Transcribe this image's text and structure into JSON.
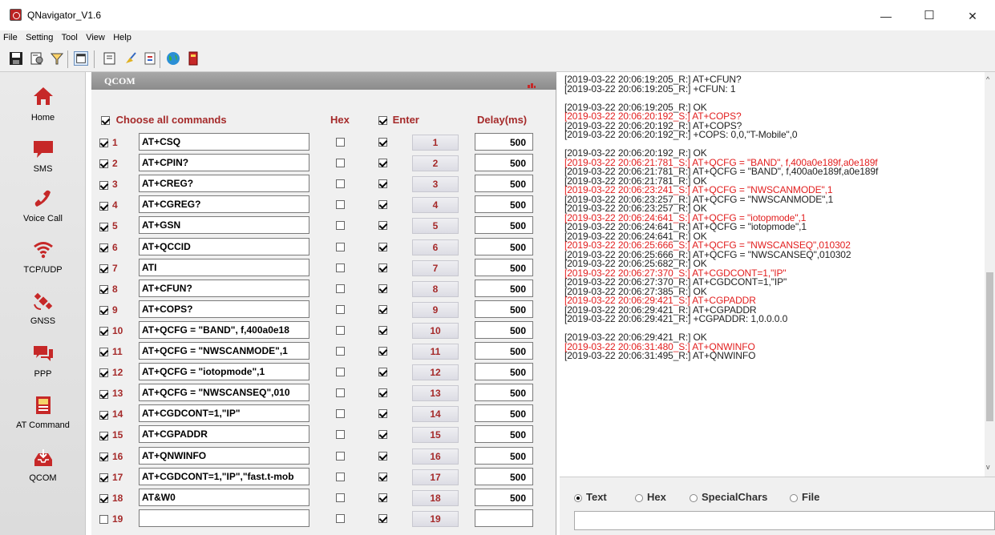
{
  "window": {
    "title": "QNavigator_V1.6",
    "minimize": "—",
    "maximize": "☐",
    "close": "✕"
  },
  "menu": [
    "File",
    "Setting",
    "Tool",
    "View",
    "Help"
  ],
  "toolbar_icons": [
    "save-icon",
    "settings-icon",
    "filter-icon",
    "new-window-icon",
    "edit-icon",
    "clear-icon",
    "notes-icon",
    "globe-icon",
    "book-icon"
  ],
  "sidebar": [
    {
      "label": "Home",
      "icon": "home-icon"
    },
    {
      "label": "SMS",
      "icon": "sms-icon"
    },
    {
      "label": "Voice Call",
      "icon": "phone-icon"
    },
    {
      "label": "TCP/UDP",
      "icon": "wifi-icon"
    },
    {
      "label": "GNSS",
      "icon": "satellite-icon"
    },
    {
      "label": "PPP",
      "icon": "chat-icon"
    },
    {
      "label": "AT Command",
      "icon": "terminal-icon"
    },
    {
      "label": "QCOM",
      "icon": "inbox-icon"
    }
  ],
  "panel": {
    "title": "QCOM",
    "choose_all": "Choose all commands",
    "hex": "Hex",
    "enter": "Enter",
    "delay": "Delay(ms)"
  },
  "commands": [
    {
      "num": "1",
      "checked": true,
      "cmd": "AT+CSQ",
      "hex": false,
      "enter": true,
      "btn": "1",
      "delay": "500"
    },
    {
      "num": "2",
      "checked": true,
      "cmd": "AT+CPIN?",
      "hex": false,
      "enter": true,
      "btn": "2",
      "delay": "500"
    },
    {
      "num": "3",
      "checked": true,
      "cmd": "AT+CREG?",
      "hex": false,
      "enter": true,
      "btn": "3",
      "delay": "500"
    },
    {
      "num": "4",
      "checked": true,
      "cmd": "AT+CGREG?",
      "hex": false,
      "enter": true,
      "btn": "4",
      "delay": "500"
    },
    {
      "num": "5",
      "checked": true,
      "cmd": "AT+GSN",
      "hex": false,
      "enter": true,
      "btn": "5",
      "delay": "500"
    },
    {
      "num": "6",
      "checked": true,
      "cmd": "AT+QCCID",
      "hex": false,
      "enter": true,
      "btn": "6",
      "delay": "500"
    },
    {
      "num": "7",
      "checked": true,
      "cmd": "ATI",
      "hex": false,
      "enter": true,
      "btn": "7",
      "delay": "500"
    },
    {
      "num": "8",
      "checked": true,
      "cmd": "AT+CFUN?",
      "hex": false,
      "enter": true,
      "btn": "8",
      "delay": "500"
    },
    {
      "num": "9",
      "checked": true,
      "cmd": "AT+COPS?",
      "hex": false,
      "enter": true,
      "btn": "9",
      "delay": "500"
    },
    {
      "num": "10",
      "checked": true,
      "cmd": "AT+QCFG = \"BAND\", f,400a0e18",
      "hex": false,
      "enter": true,
      "btn": "10",
      "delay": "500"
    },
    {
      "num": "11",
      "checked": true,
      "cmd": "AT+QCFG = \"NWSCANMODE\",1",
      "hex": false,
      "enter": true,
      "btn": "11",
      "delay": "500"
    },
    {
      "num": "12",
      "checked": true,
      "cmd": "AT+QCFG = \"iotopmode\",1",
      "hex": false,
      "enter": true,
      "btn": "12",
      "delay": "500"
    },
    {
      "num": "13",
      "checked": true,
      "cmd": "AT+QCFG = \"NWSCANSEQ\",010",
      "hex": false,
      "enter": true,
      "btn": "13",
      "delay": "500"
    },
    {
      "num": "14",
      "checked": true,
      "cmd": "AT+CGDCONT=1,\"IP\"",
      "hex": false,
      "enter": true,
      "btn": "14",
      "delay": "500"
    },
    {
      "num": "15",
      "checked": true,
      "cmd": "AT+CGPADDR",
      "hex": false,
      "enter": true,
      "btn": "15",
      "delay": "500"
    },
    {
      "num": "16",
      "checked": true,
      "cmd": "AT+QNWINFO",
      "hex": false,
      "enter": true,
      "btn": "16",
      "delay": "500"
    },
    {
      "num": "17",
      "checked": true,
      "cmd": "AT+CGDCONT=1,\"IP\",\"fast.t-mob",
      "hex": false,
      "enter": true,
      "btn": "17",
      "delay": "500"
    },
    {
      "num": "18",
      "checked": true,
      "cmd": "AT&W0",
      "hex": false,
      "enter": true,
      "btn": "18",
      "delay": "500"
    },
    {
      "num": "19",
      "checked": false,
      "cmd": "",
      "hex": false,
      "enter": true,
      "btn": "19",
      "delay": ""
    }
  ],
  "log": [
    {
      "t": "[2019-03-22 20:06:19:205_R:] AT+CFUN?",
      "s": false
    },
    {
      "t": "[2019-03-22 20:06:19:205_R:] +CFUN: 1",
      "s": false
    },
    {
      "t": "",
      "s": false
    },
    {
      "t": "[2019-03-22 20:06:19:205_R:] OK",
      "s": false
    },
    {
      "t": "[2019-03-22 20:06:20:192_S:] AT+COPS?",
      "s": true
    },
    {
      "t": "[2019-03-22 20:06:20:192_R:] AT+COPS?",
      "s": false
    },
    {
      "t": "[2019-03-22 20:06:20:192_R:] +COPS: 0,0,\"T-Mobile\",0",
      "s": false
    },
    {
      "t": "",
      "s": false
    },
    {
      "t": "[2019-03-22 20:06:20:192_R:] OK",
      "s": false
    },
    {
      "t": "[2019-03-22 20:06:21:781_S:] AT+QCFG = \"BAND\", f,400a0e189f,a0e189f",
      "s": true
    },
    {
      "t": "[2019-03-22 20:06:21:781_R:] AT+QCFG = \"BAND\", f,400a0e189f,a0e189f",
      "s": false
    },
    {
      "t": "[2019-03-22 20:06:21:781_R:] OK",
      "s": false
    },
    {
      "t": "[2019-03-22 20:06:23:241_S:] AT+QCFG = \"NWSCANMODE\",1",
      "s": true
    },
    {
      "t": "[2019-03-22 20:06:23:257_R:] AT+QCFG = \"NWSCANMODE\",1",
      "s": false
    },
    {
      "t": "[2019-03-22 20:06:23:257_R:] OK",
      "s": false
    },
    {
      "t": "[2019-03-22 20:06:24:641_S:] AT+QCFG = \"iotopmode\",1",
      "s": true
    },
    {
      "t": "[2019-03-22 20:06:24:641_R:] AT+QCFG = \"iotopmode\",1",
      "s": false
    },
    {
      "t": "[2019-03-22 20:06:24:641_R:] OK",
      "s": false
    },
    {
      "t": "[2019-03-22 20:06:25:666_S:] AT+QCFG = \"NWSCANSEQ\",010302",
      "s": true
    },
    {
      "t": "[2019-03-22 20:06:25:666_R:] AT+QCFG = \"NWSCANSEQ\",010302",
      "s": false
    },
    {
      "t": "[2019-03-22 20:06:25:682_R:] OK",
      "s": false
    },
    {
      "t": "[2019-03-22 20:06:27:370_S:] AT+CGDCONT=1,\"IP\"",
      "s": true
    },
    {
      "t": "[2019-03-22 20:06:27:370_R:] AT+CGDCONT=1,\"IP\"",
      "s": false
    },
    {
      "t": "[2019-03-22 20:06:27:385_R:] OK",
      "s": false
    },
    {
      "t": "[2019-03-22 20:06:29:421_S:] AT+CGPADDR",
      "s": true
    },
    {
      "t": "[2019-03-22 20:06:29:421_R:] AT+CGPADDR",
      "s": false
    },
    {
      "t": "[2019-03-22 20:06:29:421_R:] +CGPADDR: 1,0.0.0.0",
      "s": false
    },
    {
      "t": "",
      "s": false
    },
    {
      "t": "[2019-03-22 20:06:29:421_R:] OK",
      "s": false
    },
    {
      "t": "[2019-03-22 20:06:31:480_S:] AT+QNWINFO",
      "s": true
    },
    {
      "t": "[2019-03-22 20:06:31:495_R:] AT+QNWINFO",
      "s": false
    }
  ],
  "modes": [
    {
      "label": "Text",
      "selected": true
    },
    {
      "label": "Hex",
      "selected": false
    },
    {
      "label": "SpecialChars",
      "selected": false
    },
    {
      "label": "File",
      "selected": false
    }
  ],
  "colors": {
    "send_text": "#a52a2a",
    "log_sent": "#e21e1e"
  }
}
